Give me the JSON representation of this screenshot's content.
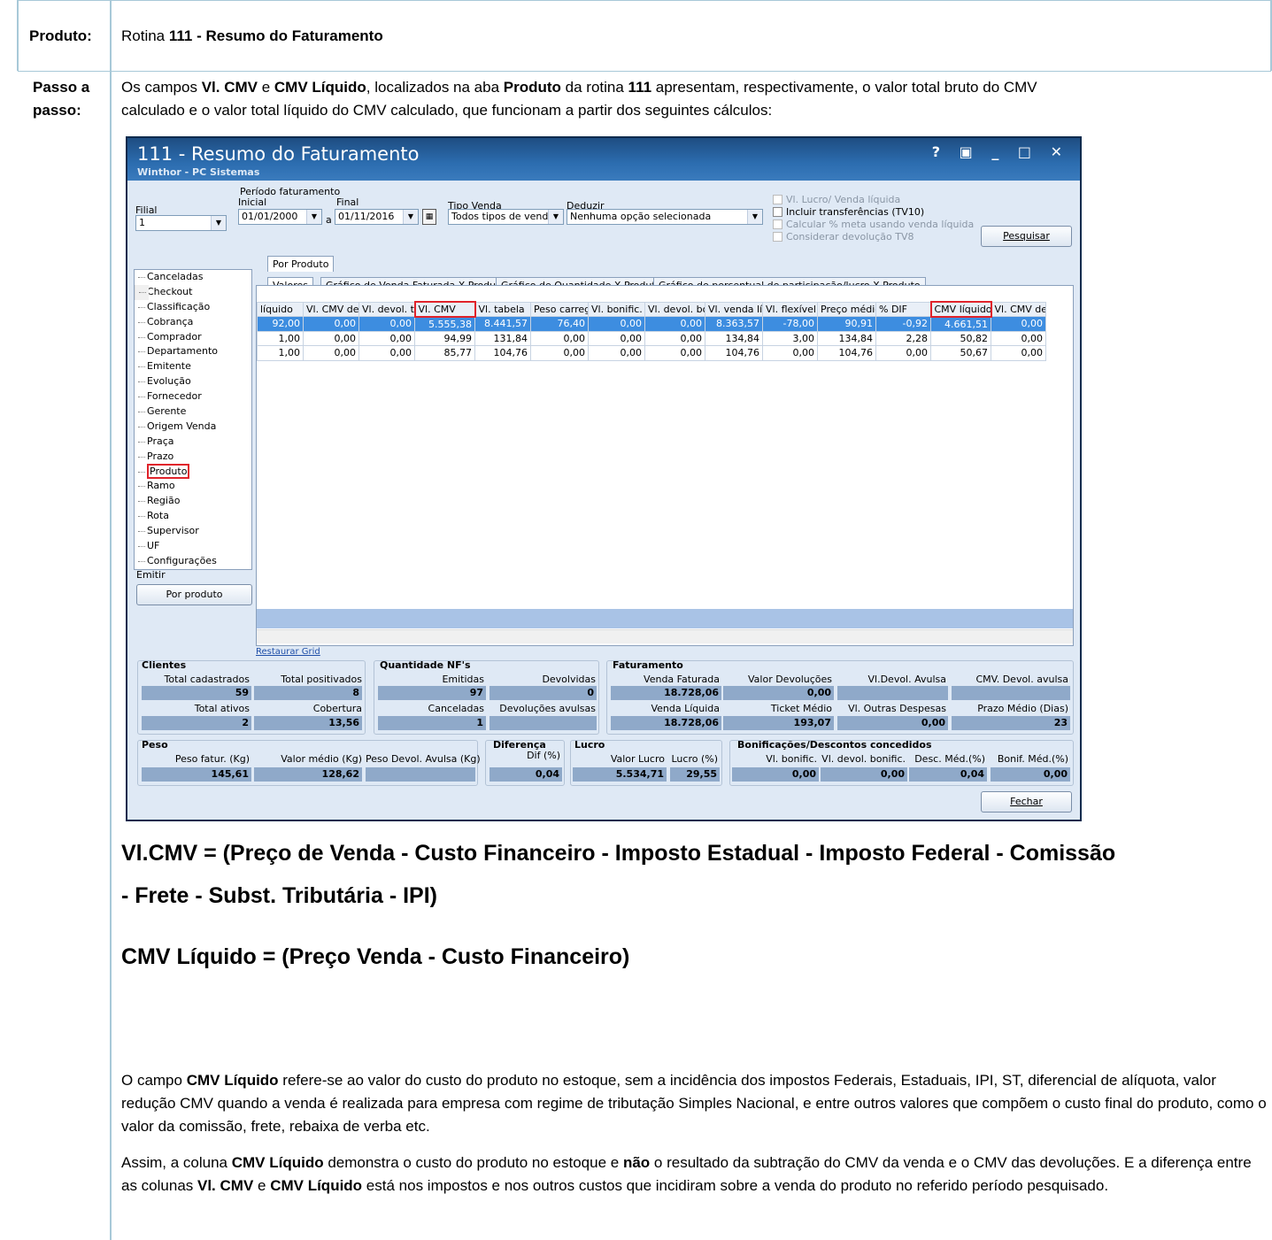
{
  "doc": {
    "label_produto": "Produto:",
    "produto_prefix": "Rotina ",
    "produto_bold": "111 - Resumo do Faturamento",
    "label_passo1": "Passo a",
    "label_passo2": "passo:",
    "intro": [
      {
        "t": "Os campos ",
        "b": false
      },
      {
        "t": "Vl. CMV",
        "b": true
      },
      {
        "t": " e ",
        "b": false
      },
      {
        "t": "CMV Líquido",
        "b": true
      },
      {
        "t": ", localizados na aba ",
        "b": false
      },
      {
        "t": "Produto",
        "b": true
      },
      {
        "t": "  da rotina ",
        "b": false
      },
      {
        "t": "111",
        "b": true
      },
      {
        "t": " apresentam, respectivamente, o valor total bruto do CMV",
        "b": false
      }
    ],
    "intro_line2": "calculado e o valor total líquido do CMV calculado, que funcionam a partir dos seguintes cálculos:",
    "formula1_l1": "Vl.CMV = (Preço de Venda - Custo Financeiro - Imposto Estadual - Imposto Federal - Comissão",
    "formula1_l2": "-  Frete - Subst. Tributária - IPI)",
    "formula2": "CMV Líquido = (Preço Venda - Custo Financeiro)",
    "p1_a": "O campo ",
    "p1_b": "CMV Líquido",
    "p1_c": " refere-se ao valor do custo do produto no estoque, sem a incidência dos impostos Federais, Estaduais, IPI, ST, diferencial de alíquota, valor redução CMV quando a venda é realizada para empresa com regime de tributação Simples Nacional, e entre outros valores que compõem o custo final do produto, como o valor da comissão, frete, rebaixa de verba etc.",
    "p2_a": "Assim, a coluna ",
    "p2_b": "CMV Líquido",
    "p2_c": " demonstra o custo do produto no estoque e ",
    "p2_d": "não",
    "p2_e": " o resultado da subtração do CMV da venda e o CMV das devoluções. E a diferença entre as colunas ",
    "p2_f": "Vl. CMV",
    "p2_g": " e ",
    "p2_h": "CMV Líquido",
    "p2_i": " está nos impostos e nos outros custos que incidiram sobre a venda do produto no referido período pesquisado."
  },
  "app": {
    "title": "111 - Resumo do Faturamento",
    "subtitle": "Winthor - PC Sistemas",
    "window_buttons": "? ▣ _ □ ✕",
    "filial_label": "Filial",
    "filial_value": "1",
    "periodo_label": "Período faturamento",
    "inicial_label": "Inicial",
    "inicial_value": "01/01/2000",
    "a_label": "a",
    "final_label": "Final",
    "final_value": "01/11/2016",
    "tipo_label": "Tipo Venda",
    "tipo_value": "Todos tipos de venda",
    "deduzir_label": "Deduzir",
    "deduzir_value": "Nenhuma opção selecionada",
    "check_lucro": "Vl. Lucro/ Venda líquida",
    "check_transf": "Incluir transferências  (TV10)",
    "check_meta": "Calcular % meta usando venda líquida",
    "check_dev": "Considerar devolução TV8",
    "pesquisar": "Pesquisar",
    "tab_por_produto": "Por Produto",
    "subtabs": [
      "Valores",
      "Gráfico de Venda Faturada X Produto",
      "Gráfico de Quantidade X Produto",
      "Gráfico de percentual de participação/lucro X Produto"
    ],
    "tree": [
      "Canceladas",
      "Checkout",
      "Classificação",
      "Cobrança",
      "Comprador",
      "Departamento",
      "Emitente",
      "Evolução",
      "Fornecedor",
      "Gerente",
      "Origem Venda",
      "Praça",
      "Prazo",
      "Produto",
      "Ramo",
      "Região",
      "Rota",
      "Supervisor",
      "UF",
      "Configurações"
    ],
    "emitir_label": "Emitir",
    "por_produto_btn": "Por produto",
    "grid_headers": [
      "líquido",
      "Vl. CMV devo",
      "Vl. devol. ta",
      "Vl. CMV",
      "Vl. tabela",
      "Peso carreg",
      "Vl. bonific.",
      "Vl. devol. bo",
      "Vl. venda líq",
      "Vl. flexível",
      "Preço médio",
      "% DIF",
      "CMV líquido",
      "Vl. CMV devo"
    ],
    "grid_rows": [
      [
        "92,00",
        "0,00",
        "0,00",
        "5.555,38",
        "8.441,57",
        "76,40",
        "0,00",
        "0,00",
        "8.363,57",
        "-78,00",
        "90,91",
        "-0,92",
        "4.661,51",
        "0,00"
      ],
      [
        "1,00",
        "0,00",
        "0,00",
        "94,99",
        "131,84",
        "0,00",
        "0,00",
        "0,00",
        "134,84",
        "3,00",
        "134,84",
        "2,28",
        "50,82",
        "0,00"
      ],
      [
        "1,00",
        "0,00",
        "0,00",
        "85,77",
        "104,76",
        "0,00",
        "0,00",
        "0,00",
        "104,76",
        "0,00",
        "104,76",
        "0,00",
        "50,67",
        "0,00"
      ]
    ],
    "restaurar": "Restaurar Grid",
    "clientes": {
      "title": "Clientes",
      "total_cadastrados_label": "Total cadastrados",
      "total_cadastrados": "59",
      "total_positivados_label": "Total positivados",
      "total_positivados": "8",
      "total_ativos_label": "Total ativos",
      "total_ativos": "2",
      "cobertura_label": "Cobertura",
      "cobertura": "13,56"
    },
    "qtd_nf": {
      "title": "Quantidade NF's",
      "emitidas_label": "Emitidas",
      "emitidas": "97",
      "devolvidas_label": "Devolvidas",
      "devolvidas": "0",
      "canceladas_label": "Canceladas",
      "canceladas": "1",
      "dev_avulsas_label": "Devoluções avulsas",
      "dev_avulsas": ""
    },
    "faturamento": {
      "title": "Faturamento",
      "venda_faturada_label": "Venda Faturada",
      "venda_faturada": "18.728,06",
      "valor_devolucoes_label": "Valor Devoluções",
      "valor_devolucoes": "0,00",
      "vl_devol_avulsa_label": "Vl.Devol. Avulsa",
      "vl_devol_avulsa": "",
      "cmv_devol_avulsa_label": "CMV. Devol. avulsa",
      "cmv_devol_avulsa": "",
      "venda_liquida_label": "Venda Líquida",
      "venda_liquida": "18.728,06",
      "ticket_medio_label": "Ticket Médio",
      "ticket_medio": "193,07",
      "outras_despesas_label": "Vl. Outras Despesas",
      "outras_despesas": "0,00",
      "prazo_medio_label": "Prazo Médio (Dias)",
      "prazo_medio": "23"
    },
    "peso": {
      "title": "Peso",
      "peso_fatur_label": "Peso fatur. (Kg)",
      "peso_fatur": "145,61",
      "valor_medio_label": "Valor médio (Kg)",
      "valor_medio": "128,62",
      "peso_devol_label": "Peso Devol. Avulsa (Kg)",
      "peso_devol": ""
    },
    "diferenca": {
      "title": "Diferença",
      "dif_label": "Dif (%)",
      "dif": "0,04"
    },
    "lucro": {
      "title": "Lucro",
      "valor_lucro_label": "Valor Lucro",
      "valor_lucro": "5.534,71",
      "lucro_pct_label": "Lucro (%)",
      "lucro_pct": "29,55"
    },
    "bonif": {
      "title": "Bonificações/Descontos concedidos",
      "vl_bonific_label": "Vl. bonific.",
      "vl_bonific": "0,00",
      "vl_devol_bonific_label": "Vl. devol. bonific.",
      "vl_devol_bonific": "0,00",
      "desc_med_label": "Desc. Méd.(%)",
      "desc_med": "0,04",
      "bonif_med_label": "Bonif. Méd.(%)",
      "bonif_med": "0,00"
    },
    "fechar": "Fechar"
  }
}
